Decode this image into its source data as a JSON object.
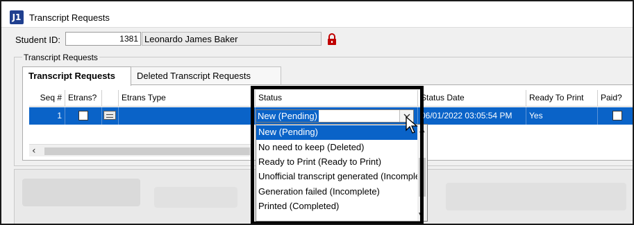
{
  "window": {
    "title": "Transcript Requests",
    "icon_text": "J1",
    "icon": "app-logo-icon"
  },
  "student": {
    "id_label": "Student ID:",
    "id_value": "1381",
    "name": "Leonardo James Baker",
    "lock_icon": "lock-icon",
    "lock_color": "#c00000"
  },
  "group": {
    "label": "Transcript Requests"
  },
  "tabs": [
    {
      "label": "Transcript Requests",
      "active": true
    },
    {
      "label": "Deleted Transcript Requests",
      "active": false
    }
  ],
  "grid": {
    "columns": [
      "Seq #",
      "Etrans?",
      "",
      "Etrans Type",
      "Status",
      "Status Date",
      "Ready To Print",
      "Paid?"
    ],
    "rows": [
      {
        "seq": "1",
        "etrans": false,
        "etrans_type": "",
        "status": "New (Pending)",
        "status_date": "06/01/2022 03:05:54 PM",
        "ready_to_print": "Yes",
        "paid": false
      }
    ]
  },
  "status_dropdown": {
    "options": [
      "New (Pending)",
      "No need to keep (Deleted)",
      "Ready to Print (Ready to Print)",
      "Unofficial transcript generated (Incomplete)",
      "Generation failed (Incomplete)",
      "Printed (Completed)"
    ],
    "selected_index": 0
  },
  "colors": {
    "selection": "#0a63c8",
    "highlight_border": "#000000"
  }
}
